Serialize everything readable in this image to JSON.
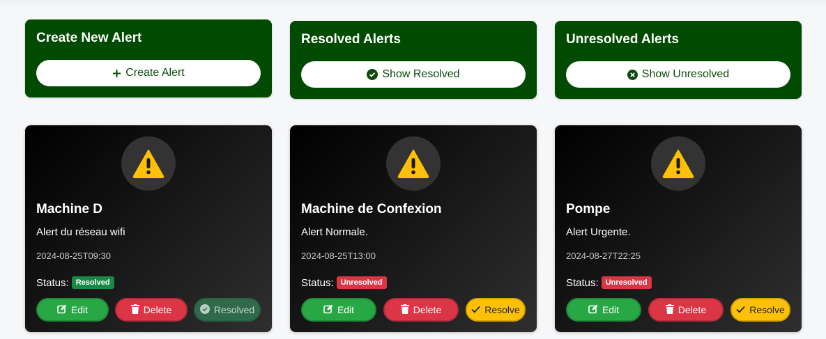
{
  "colors": {
    "top_card_bg": "#014a01",
    "edit": "#28a745",
    "delete": "#dc3545",
    "resolve": "#ffc107",
    "badge_resolved": "#198a46",
    "badge_unresolved": "#dc3545",
    "warning": "#ffc107"
  },
  "top_cards": [
    {
      "title": "Create New Alert",
      "button_label": "Create Alert",
      "icon": "plus-icon"
    },
    {
      "title": "Resolved Alerts",
      "button_label": "Show Resolved",
      "icon": "check-circle-icon"
    },
    {
      "title": "Unresolved Alerts",
      "button_label": "Show Unresolved",
      "icon": "x-circle-icon"
    }
  ],
  "alerts": [
    {
      "name": "Machine D",
      "description": "Alert du réseau wifi",
      "timestamp": "2024-08-25T09:30",
      "status_label": "Status:",
      "status": "Resolved",
      "edit_label": "Edit",
      "delete_label": "Delete",
      "action_label": "Resolved",
      "icon": "warning-icon"
    },
    {
      "name": "Machine de Confexion",
      "description": "Alert Normale.",
      "timestamp": "2024-08-25T13:00",
      "status_label": "Status:",
      "status": "Unresolved",
      "edit_label": "Edit",
      "delete_label": "Delete",
      "action_label": "Resolve",
      "icon": "warning-icon"
    },
    {
      "name": "Pompe",
      "description": "Alert Urgente.",
      "timestamp": "2024-08-27T22:25",
      "status_label": "Status:",
      "status": "Unresolved",
      "edit_label": "Edit",
      "delete_label": "Delete",
      "action_label": "Resolve",
      "icon": "warning-icon"
    }
  ]
}
